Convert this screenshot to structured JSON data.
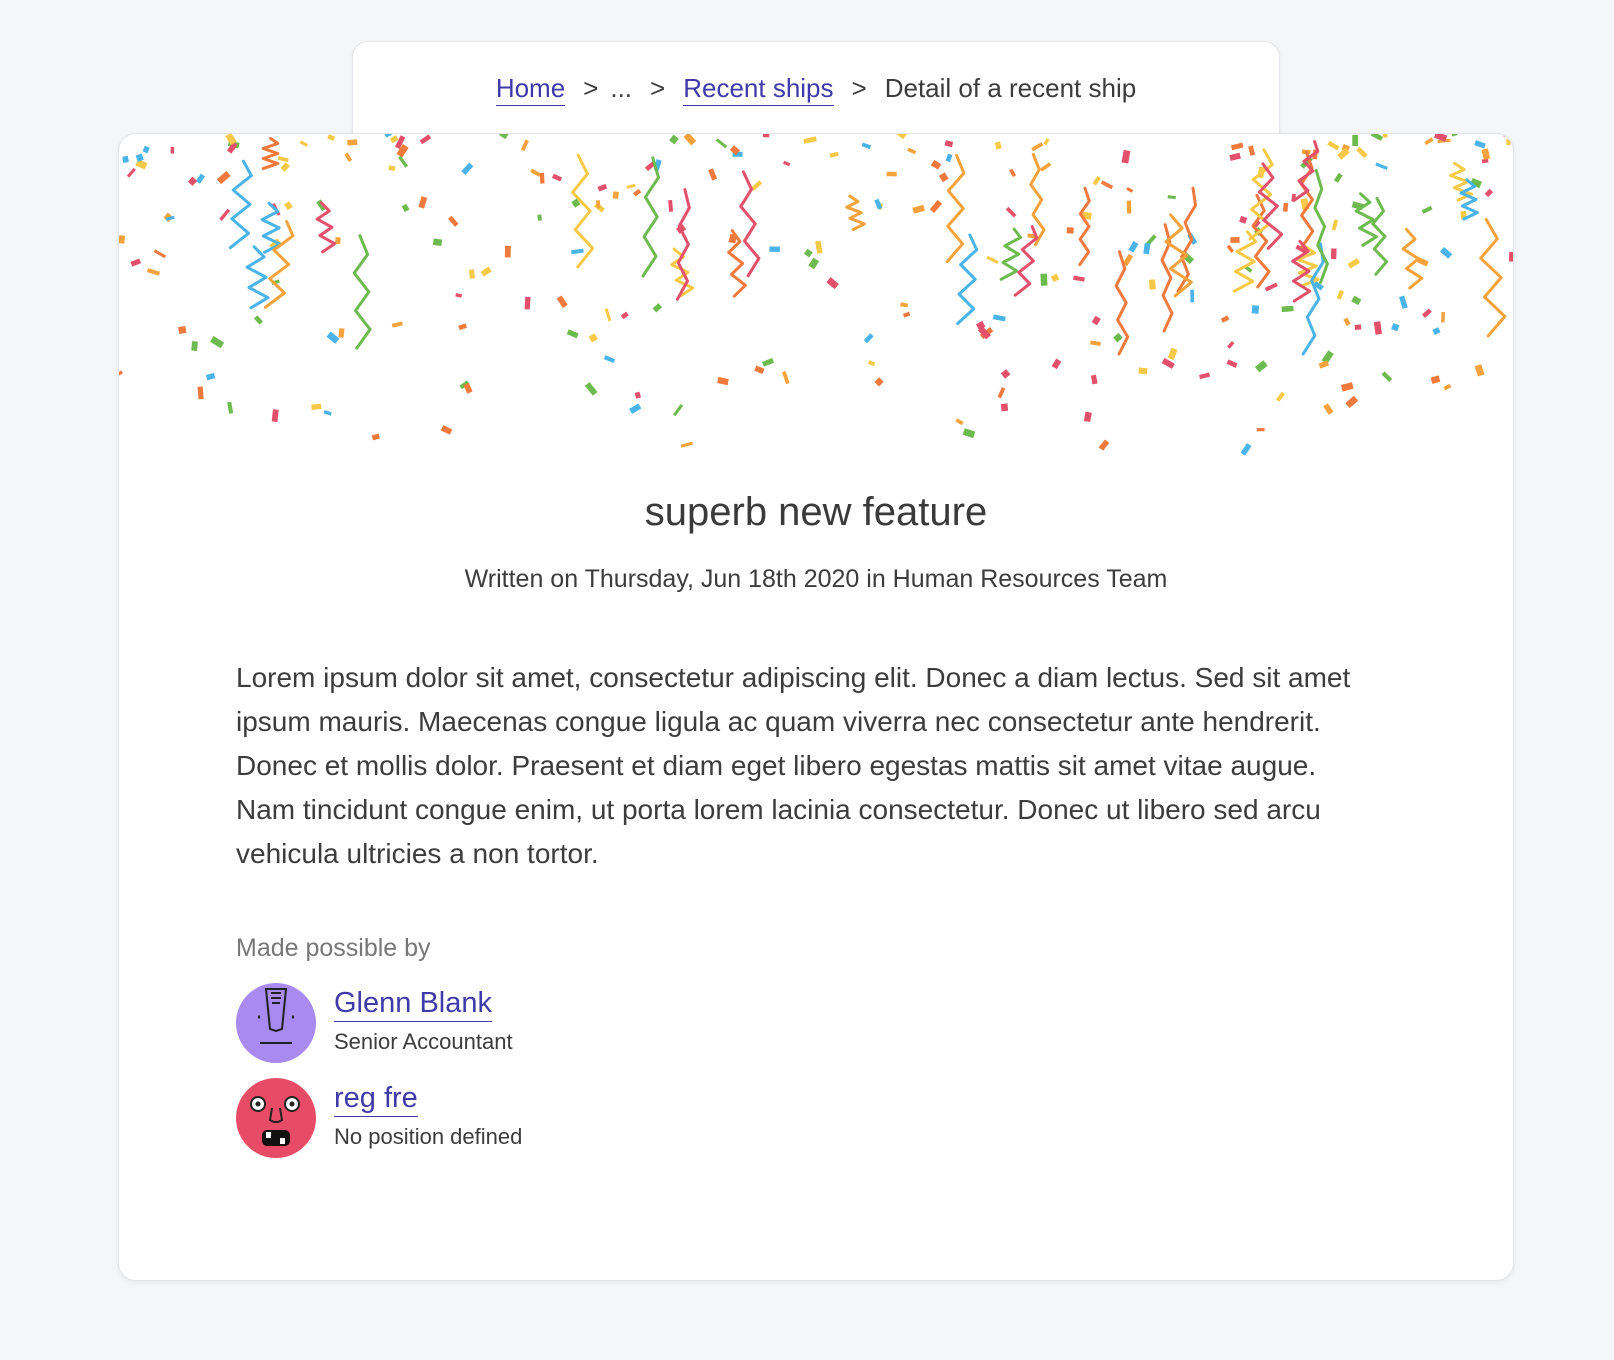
{
  "breadcrumb": {
    "home": "Home",
    "separator": ">",
    "ellipsis": "...",
    "recent_ships": "Recent ships",
    "current": "Detail of a recent ship"
  },
  "ship": {
    "title": "superb new feature",
    "meta": "Written on Thursday, Jun 18th 2020 in Human Resources Team",
    "body": "Lorem ipsum dolor sit amet, consectetur adipiscing elit. Donec a diam lectus. Sed sit amet ipsum mauris. Maecenas congue ligula ac quam viverra nec consectetur ante hendrerit. Donec et mollis dolor. Praesent et diam eget libero egestas mattis sit amet vitae augue. Nam tincidunt congue enim, ut porta lorem lacinia consectetur. Donec ut libero sed arcu vehicula ultricies a non tortor.",
    "made_possible_label": "Made possible by",
    "contributors": [
      {
        "name": "Glenn Blank",
        "position": "Senior Accountant",
        "avatar_color": "#a98af0",
        "avatar_icon": "purple-face-icon"
      },
      {
        "name": "reg fre",
        "position": "No position defined",
        "avatar_color": "#e84b66",
        "avatar_icon": "red-face-icon"
      }
    ]
  },
  "colors": {
    "background": "#f5f6f8",
    "link": "#3f3aa8",
    "text": "#3c3c3c",
    "muted": "#777777"
  },
  "decoration": {
    "banner_icon": "confetti-icon"
  }
}
